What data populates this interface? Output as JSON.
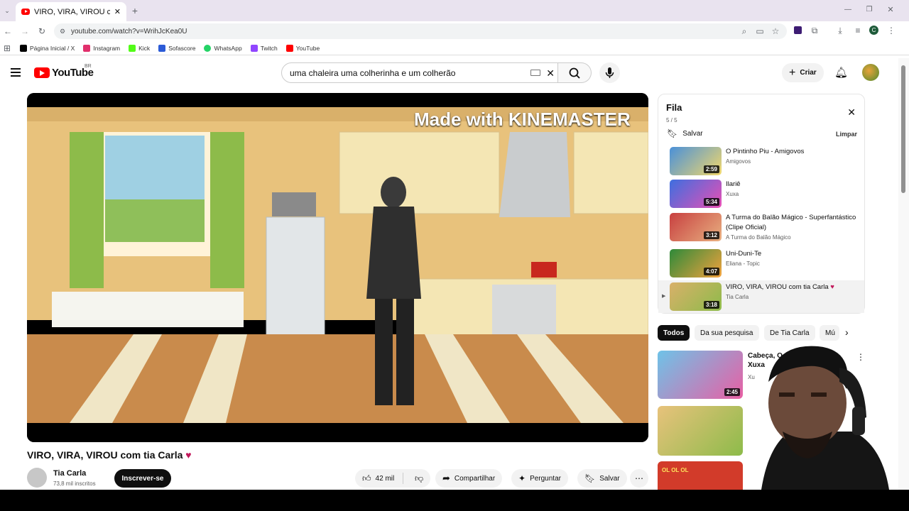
{
  "browser": {
    "tab_title": "VIRO, VIRA, VIROU com tia Carl",
    "url": "youtube.com/watch?v=WrihJcKea0U",
    "bookmarks": [
      "Página Inicial / X",
      "Instagram",
      "Kick",
      "Sofascore",
      "WhatsApp",
      "Twitch",
      "YouTube"
    ],
    "profile_letter": "C"
  },
  "header": {
    "logo": "YouTube",
    "region": "BR",
    "search_value": "uma chaleira uma colherinha e um colherão",
    "create_label": "Criar"
  },
  "video": {
    "watermark": "Made with KINEMASTER",
    "title": "VIRO, VIRA, VIROU com tia Carla",
    "channel": "Tia Carla",
    "subscribers": "73,8 mil inscritos",
    "subscribe_label": "Inscrever-se",
    "likes": "42 mil",
    "share_label": "Compartilhar",
    "ask_label": "Perguntar",
    "save_label": "Salvar"
  },
  "queue": {
    "title": "Fila",
    "position": "5 / 5",
    "save_label": "Salvar",
    "clear_label": "Limpar",
    "items": [
      {
        "title": "O Pintinho Piu - Amigovos",
        "channel": "Amigovos",
        "duration": "2:59"
      },
      {
        "title": "Ilariê",
        "channel": "Xuxa",
        "duration": "5:34"
      },
      {
        "title": "A Turma do Balão Mágico - Superfantástico (Clipe Oficial)",
        "channel": "A Turma do Balão Mágico",
        "duration": "3:12"
      },
      {
        "title": "Uni-Duni-Te",
        "channel": "Eliana - Topic",
        "duration": "4:07"
      },
      {
        "title": "VIRO, VIRA, VIROU com tia Carla",
        "channel": "Tia Carla",
        "duration": "3:18"
      }
    ]
  },
  "chips": [
    "Todos",
    "Da sua pesquisa",
    "De Tia Carla",
    "Mú"
  ],
  "recommendations": [
    {
      "title": "Cabeça, O",
      "channel": "Xuxa",
      "duration": "2:45"
    },
    {
      "title": "",
      "channel": "",
      "duration": ""
    },
    {
      "title": "",
      "channel": "",
      "duration": ""
    }
  ],
  "rec_texts": {
    "title_line2": "Xuxa",
    "channel_cut": "Xu",
    "badge3": "OL OL OL"
  },
  "colors": {
    "brand_red": "#ff0000",
    "text": "#0f0f0f",
    "secondary": "#606060",
    "chip_active": "#0f0f0f"
  }
}
